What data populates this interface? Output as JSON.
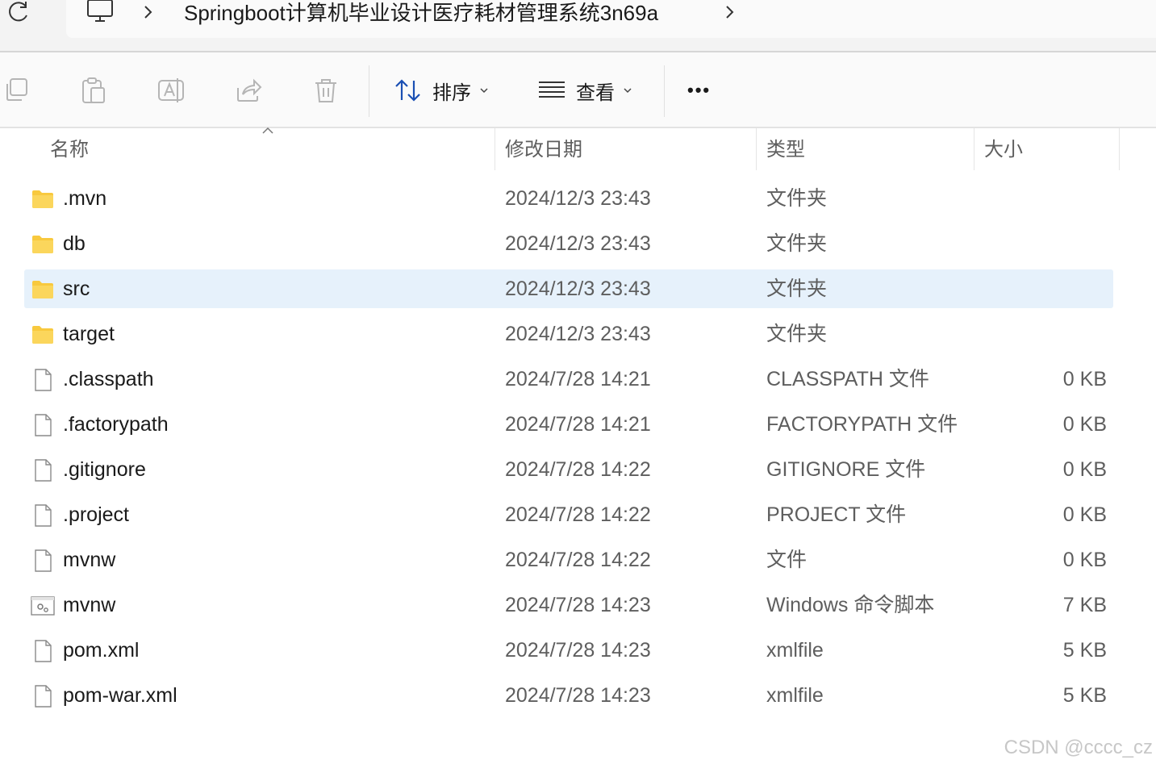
{
  "address_bar": {
    "path": "Springboot计算机毕业设计医疗耗材管理系统3n69a"
  },
  "toolbar": {
    "icons": [
      "copy-icon",
      "paste-icon",
      "rename-icon",
      "share-icon",
      "delete-icon"
    ],
    "sort_label": "排序",
    "view_label": "查看",
    "more_label": "•••"
  },
  "columns": {
    "name": "名称",
    "date": "修改日期",
    "type": "类型",
    "size": "大小"
  },
  "files": [
    {
      "name": ".mvn",
      "date": "2024/12/3 23:43",
      "type": "文件夹",
      "size": "",
      "icon": "folder-icon",
      "selected": false
    },
    {
      "name": "db",
      "date": "2024/12/3 23:43",
      "type": "文件夹",
      "size": "",
      "icon": "folder-icon",
      "selected": false
    },
    {
      "name": "src",
      "date": "2024/12/3 23:43",
      "type": "文件夹",
      "size": "",
      "icon": "folder-icon",
      "selected": true
    },
    {
      "name": "target",
      "date": "2024/12/3 23:43",
      "type": "文件夹",
      "size": "",
      "icon": "folder-icon",
      "selected": false
    },
    {
      "name": ".classpath",
      "date": "2024/7/28 14:21",
      "type": "CLASSPATH 文件",
      "size": "0 KB",
      "icon": "file-icon",
      "selected": false
    },
    {
      "name": ".factorypath",
      "date": "2024/7/28 14:21",
      "type": "FACTORYPATH 文件",
      "size": "0 KB",
      "icon": "file-icon",
      "selected": false
    },
    {
      "name": ".gitignore",
      "date": "2024/7/28 14:22",
      "type": "GITIGNORE 文件",
      "size": "0 KB",
      "icon": "file-icon",
      "selected": false
    },
    {
      "name": ".project",
      "date": "2024/7/28 14:22",
      "type": "PROJECT 文件",
      "size": "0 KB",
      "icon": "file-icon",
      "selected": false
    },
    {
      "name": "mvnw",
      "date": "2024/7/28 14:22",
      "type": "文件",
      "size": "0 KB",
      "icon": "file-icon",
      "selected": false
    },
    {
      "name": "mvnw",
      "date": "2024/7/28 14:23",
      "type": "Windows 命令脚本",
      "size": "7 KB",
      "icon": "script-icon",
      "selected": false
    },
    {
      "name": "pom.xml",
      "date": "2024/7/28 14:23",
      "type": "xmlfile",
      "size": "5 KB",
      "icon": "file-icon",
      "selected": false
    },
    {
      "name": "pom-war.xml",
      "date": "2024/7/28 14:23",
      "type": "xmlfile",
      "size": "5 KB",
      "icon": "file-icon",
      "selected": false
    }
  ],
  "watermark": "CSDN @cccc_cz",
  "colors": {
    "selection": "#e6f1fb",
    "folder": "#f8c93e",
    "muted_text": "#5e5e5e"
  }
}
